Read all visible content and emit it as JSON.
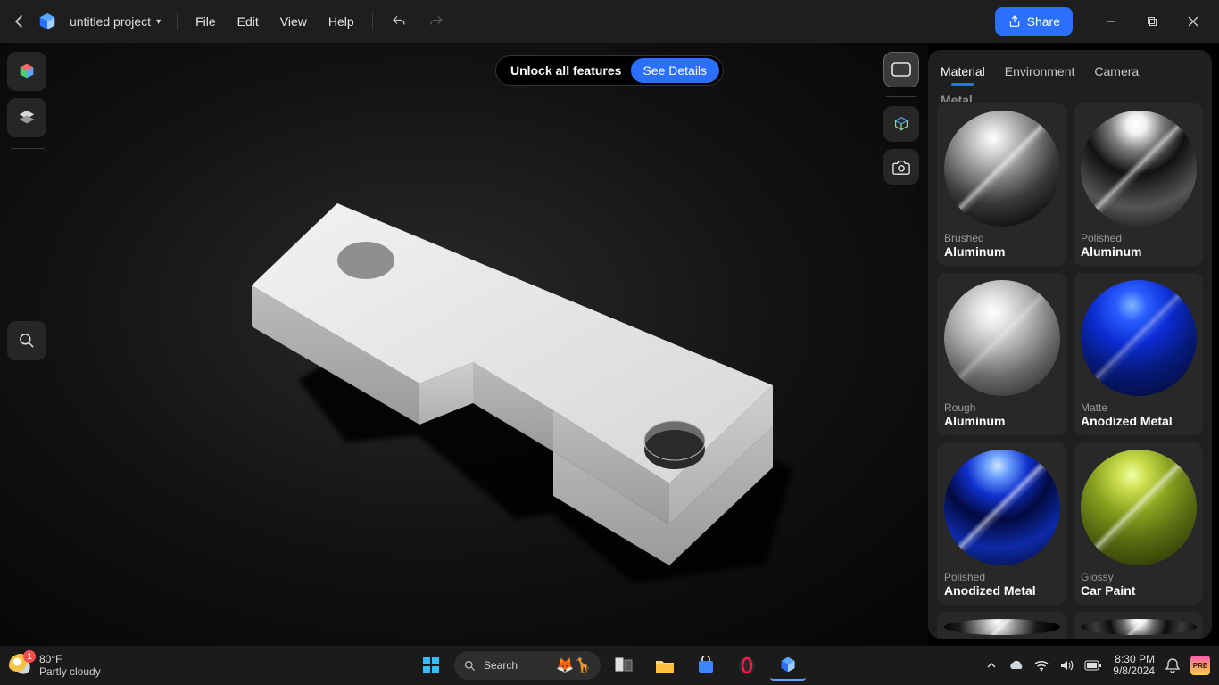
{
  "app": {
    "project_name": "untitled project",
    "menus": {
      "file": "File",
      "edit": "Edit",
      "view": "View",
      "help": "Help"
    },
    "share_label": "Share"
  },
  "promo": {
    "unlock": "Unlock all features",
    "details": "See Details"
  },
  "panel": {
    "tabs": {
      "material": "Material",
      "environment": "Environment",
      "camera": "Camera"
    },
    "category": "Metal",
    "materials": [
      {
        "sub": "Brushed",
        "name": "Aluminum"
      },
      {
        "sub": "Polished",
        "name": "Aluminum"
      },
      {
        "sub": "Rough",
        "name": "Aluminum"
      },
      {
        "sub": "Matte",
        "name": "Anodized Metal"
      },
      {
        "sub": "Polished",
        "name": "Anodized Metal"
      },
      {
        "sub": "Glossy",
        "name": "Car Paint"
      }
    ]
  },
  "taskbar": {
    "temp": "80°F",
    "condition": "Partly cloudy",
    "weather_badge": "1",
    "search_placeholder": "Search",
    "time": "8:30 PM",
    "date": "9/8/2024"
  }
}
